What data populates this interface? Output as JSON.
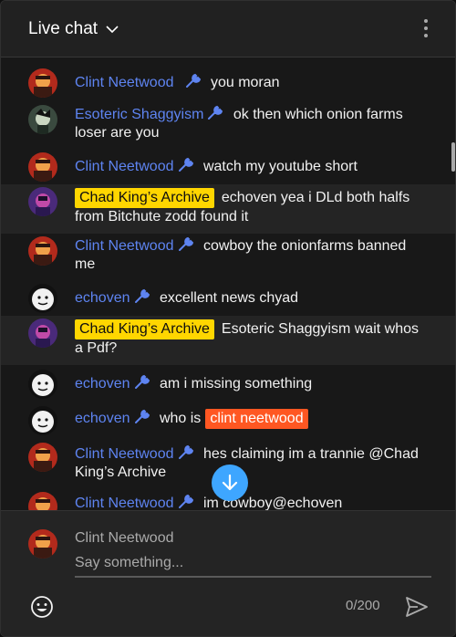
{
  "header": {
    "title": "Live chat"
  },
  "messages": [
    {
      "author": "Clint Neetwood",
      "text": "you moran"
    },
    {
      "author": "Esoteric Shaggyism",
      "text": "ok then which onion farms loser are you"
    },
    {
      "author": "Clint Neetwood",
      "text": "watch my youtube short"
    },
    {
      "author": "Chad King’s Archive",
      "text": "echoven yea i DLd both halfs from Bitchute zodd found it"
    },
    {
      "author": "Clint Neetwood",
      "text": "cowboy the onionfarms banned me"
    },
    {
      "author": "echoven",
      "text": "excellent news chyad"
    },
    {
      "author": "Chad King’s Archive",
      "text": "Esoteric Shaggyism wait whos a Pdf?"
    },
    {
      "author": "echoven",
      "text": "am i missing something"
    },
    {
      "author": "echoven",
      "text": "who is",
      "mention": "clint neetwood"
    },
    {
      "author": "Clint Neetwood",
      "text": "hes claiming im a trannie @Chad King’s Archive"
    },
    {
      "author": "Clint Neetwood",
      "text": "im cowboy@echoven"
    }
  ],
  "composer": {
    "user_name": "Clint Neetwood",
    "placeholder": "Say something...",
    "char_count": "0/200"
  },
  "icons": {
    "moderator": "wrench-icon",
    "menu": "more-vert-icon",
    "scroll": "arrow-down-icon",
    "emoji": "smiley-icon",
    "send": "send-icon"
  },
  "colors": {
    "author": "#5e84f1",
    "member_badge": "#ffd600",
    "mention": "#ff5722",
    "scroll_button": "#3ea6ff"
  }
}
